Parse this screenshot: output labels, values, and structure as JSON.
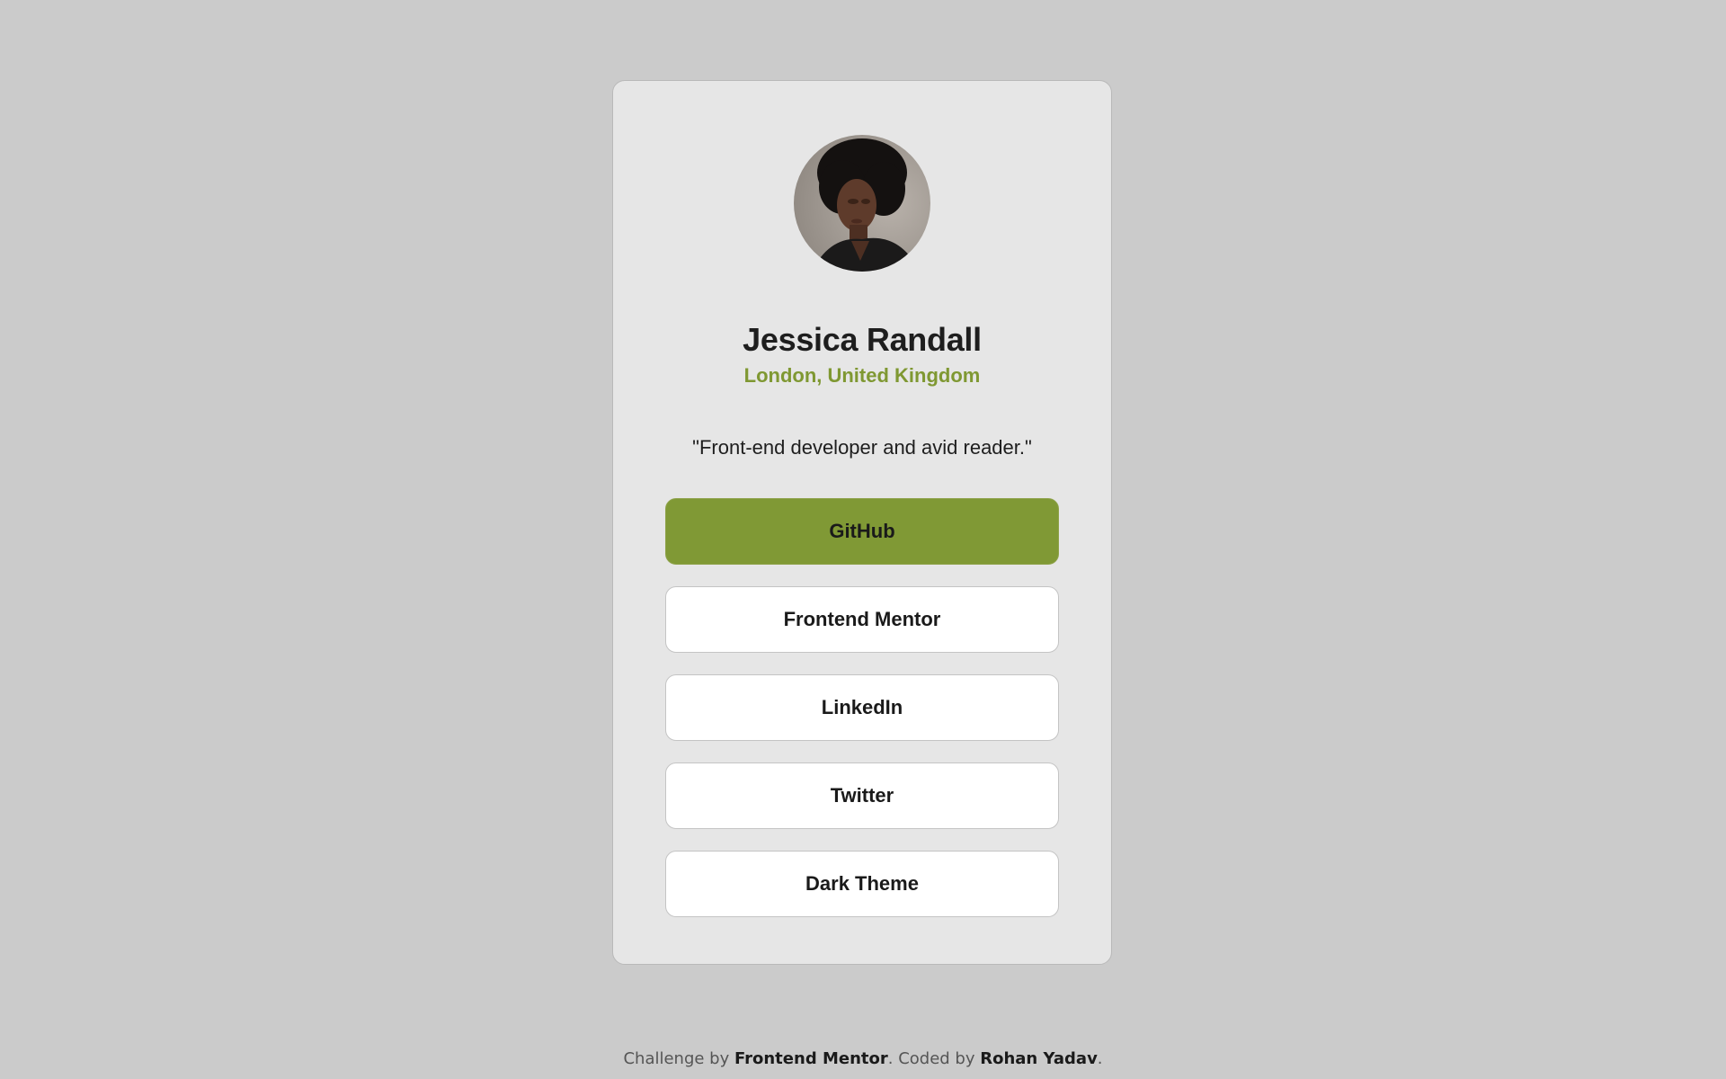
{
  "profile": {
    "name": "Jessica Randall",
    "location": "London, United Kingdom",
    "bio": "\"Front-end developer and avid reader.\""
  },
  "links": [
    {
      "label": "GitHub",
      "active": true
    },
    {
      "label": "Frontend Mentor",
      "active": false
    },
    {
      "label": "LinkedIn",
      "active": false
    },
    {
      "label": "Twitter",
      "active": false
    },
    {
      "label": "Dark Theme",
      "active": false
    }
  ],
  "footer": {
    "prefix": "Challenge by ",
    "challenge_link": "Frontend Mentor",
    "middle": ". Coded by ",
    "author_link": "Rohan Yadav",
    "suffix": "."
  },
  "colors": {
    "accent": "#809935",
    "location_text": "#7f9832",
    "page_background": "#cbcbcb",
    "card_background": "#e6e6e6"
  }
}
